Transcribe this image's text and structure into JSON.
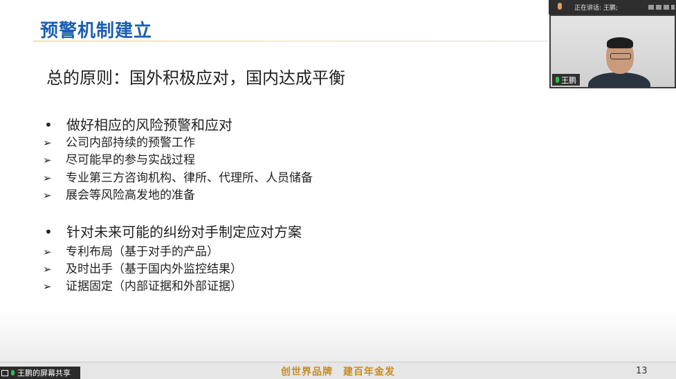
{
  "slide": {
    "title": "预警机制建立",
    "principle": "总的原则：国外积极应对，国内达成平衡",
    "sections": [
      {
        "bullet_glyph": "•",
        "heading": "做好相应的风险预警和应对",
        "items": [
          "公司内部持续的预警工作",
          "尽可能早的参与实战过程",
          "专业第三方咨询机构、律所、代理所、人员储备",
          "展会等风险高发地的准备"
        ]
      },
      {
        "bullet_glyph": "•",
        "heading": "针对未来可能的纠纷对手制定应对方案",
        "items": [
          "专利布局（基于对手的产品）",
          "及时出手（基于国内外监控结果）",
          "证据固定（内部证据和外部证据）"
        ]
      }
    ],
    "sub_glyph": "➢",
    "footer_slogan": "创世界品牌　建百年金发",
    "page_number": "13"
  },
  "meeting": {
    "speaking_label": "正在讲话: 王鹏;",
    "participant_name": "王鹏",
    "screen_share_label": "王鹏的屏幕共享"
  },
  "colors": {
    "title": "#1a5fb4",
    "slogan": "#c88a1e",
    "mic_active": "#27c24c"
  },
  "icons": [
    "mic-icon",
    "monitor-icon",
    "more-dots-icon"
  ]
}
